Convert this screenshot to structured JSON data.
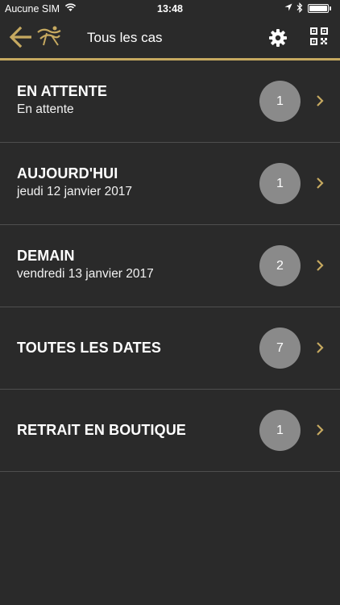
{
  "status_bar": {
    "carrier": "Aucune SIM",
    "time": "13:48",
    "icons": [
      "wifi-icon",
      "location-arrow-icon",
      "bluetooth-icon",
      "battery-icon"
    ]
  },
  "nav": {
    "title": "Tous les cas",
    "back_icon": "arrow-left-icon",
    "logo_icon": "brand-logo-icon",
    "settings_icon": "gear-icon",
    "qr_icon": "qr-code-icon",
    "accent_color": "#c6a960"
  },
  "rows": [
    {
      "title": "EN ATTENTE",
      "subtitle": "En attente",
      "count": "1"
    },
    {
      "title": "AUJOURD'HUI",
      "subtitle": "jeudi 12 janvier 2017",
      "count": "1"
    },
    {
      "title": "DEMAIN",
      "subtitle": "vendredi 13 janvier 2017",
      "count": "2"
    },
    {
      "title": "TOUTES LES DATES",
      "subtitle": "",
      "count": "7"
    },
    {
      "title": "RETRAIT EN BOUTIQUE",
      "subtitle": "",
      "count": "1"
    }
  ]
}
